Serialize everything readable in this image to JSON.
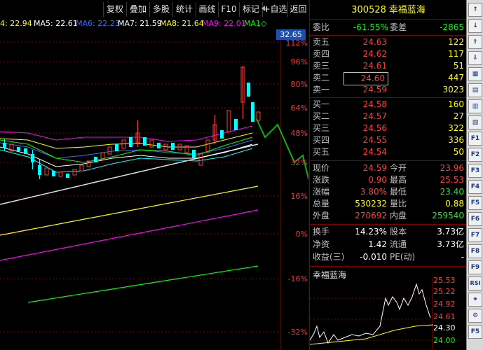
{
  "toolbar": {
    "buttons": [
      "复权",
      "叠加",
      "多股",
      "统计",
      "画线",
      "F10",
      "标记",
      "+自选",
      "返回"
    ]
  },
  "ma_legend": [
    {
      "label": "4: 22.94",
      "color": "#ffff00"
    },
    {
      "label": "MA5: 22.61",
      "color": "#ffffff"
    },
    {
      "label": "MA6: 22.23",
      "color": "#3b6cff"
    },
    {
      "label": "MA7: 21.59",
      "color": "#ffffff"
    },
    {
      "label": "MA8: 21.64",
      "color": "#ffff00"
    },
    {
      "label": "MA9: 22.01",
      "color": "#ff00ff"
    },
    {
      "label": "MA1◇",
      "color": "#00ff00"
    }
  ],
  "chart": {
    "current_price_tag": "32.65",
    "pct_labels": [
      "112%",
      "96%",
      "80%",
      "64%",
      "48%",
      "32%",
      "16%",
      "0%",
      "-16%",
      "-32%"
    ]
  },
  "stock": {
    "code": "300528",
    "name": "幸福蓝海"
  },
  "quote": {
    "weibi_label": "委比",
    "weibi_value": "-61.55%",
    "weicha_label": "委差",
    "weicha_value": "-2865",
    "asks": [
      {
        "label": "卖五",
        "price": "24.63",
        "vol": "122"
      },
      {
        "label": "卖四",
        "price": "24.62",
        "vol": "117"
      },
      {
        "label": "卖三",
        "price": "24.61",
        "vol": "51"
      },
      {
        "label": "卖二",
        "price": "24.60",
        "vol": "447"
      },
      {
        "label": "卖一",
        "price": "24.59",
        "vol": "3023"
      }
    ],
    "bids": [
      {
        "label": "买一",
        "price": "24.58",
        "vol": "160"
      },
      {
        "label": "买二",
        "price": "24.57",
        "vol": "27"
      },
      {
        "label": "买三",
        "price": "24.56",
        "vol": "322"
      },
      {
        "label": "买四",
        "price": "24.55",
        "vol": "336"
      },
      {
        "label": "买五",
        "price": "24.54",
        "vol": "50"
      }
    ],
    "stats": [
      {
        "k1": "现价",
        "v1": "24.59",
        "k2": "今开",
        "v2": "23.96"
      },
      {
        "k1": "涨跌",
        "v1": "0.90",
        "k2": "最高",
        "v2": "25.53"
      },
      {
        "k1": "涨幅",
        "v1": "3.80%",
        "k2": "最低",
        "v2": "23.40"
      },
      {
        "k1": "总量",
        "v1": "530232",
        "k2": "量比",
        "v2": "0.88"
      },
      {
        "k1": "外盘",
        "v1": "270692",
        "k2": "内盘",
        "v2": "259540"
      }
    ],
    "stats2": [
      {
        "k1": "换手",
        "v1": "14.23%",
        "k2": "股本",
        "v2": "3.73亿"
      },
      {
        "k1": "净资",
        "v1": "1.42",
        "k2": "流通",
        "v2": "3.73亿"
      },
      {
        "k1": "收益(三)",
        "v1": "-0.010",
        "k2": "PE(动)",
        "v2": "-"
      }
    ]
  },
  "mini_chart": {
    "title": "幸福蓝海",
    "axis": [
      "25.53",
      "25.22",
      "24.92",
      "24.61",
      "24.30",
      "24.00"
    ]
  },
  "iconbar": [
    "↑",
    "↓",
    "⇧",
    "⇩",
    "▦",
    "▤",
    "▥",
    "▧",
    "F1",
    "F2",
    "F3",
    "F4",
    "F5",
    "F6",
    "F7",
    "F8",
    "F9",
    "RSI",
    "⌖",
    "⚙",
    "F5"
  ]
}
